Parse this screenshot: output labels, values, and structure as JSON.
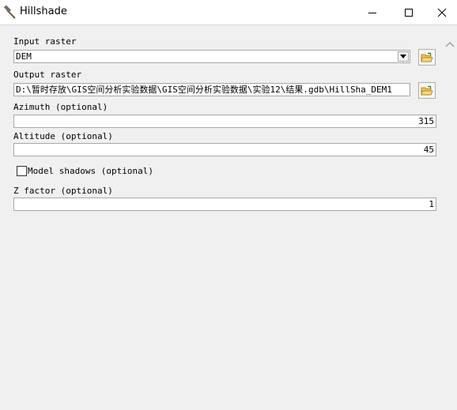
{
  "window": {
    "title": "Hillshade",
    "icon": "hammer-icon"
  },
  "form": {
    "input_raster": {
      "label": "Input raster",
      "value": "DEM"
    },
    "output_raster": {
      "label": "Output raster",
      "value": "D:\\暂时存放\\GIS空间分析实验数据\\GIS空间分析实验数据\\实验12\\结果.gdb\\HillSha_DEM1"
    },
    "azimuth": {
      "label": "Azimuth (optional)",
      "value": "315"
    },
    "altitude": {
      "label": "Altitude (optional)",
      "value": "45"
    },
    "model_shadows": {
      "label": "Model shadows (optional)",
      "checked": false
    },
    "z_factor": {
      "label": "Z factor (optional)",
      "value": "1"
    }
  },
  "colors": {
    "titlebar_bg": "#ffffff",
    "dialog_bg": "#f0f0f0",
    "field_border": "#a7a7a7",
    "folder_yellow": "#f3c24a"
  }
}
